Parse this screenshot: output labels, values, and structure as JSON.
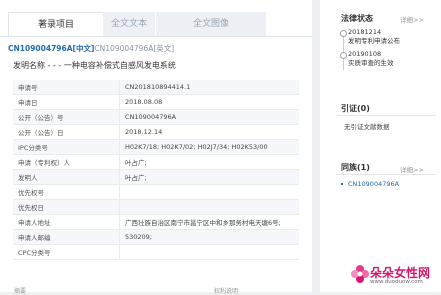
{
  "tabs": [
    {
      "label": "著录项目",
      "active": true
    },
    {
      "label": "全文文本",
      "active": false
    },
    {
      "label": "全文图像",
      "active": false
    }
  ],
  "publication": {
    "highlight": "CN109004796A[中文]",
    "alt": "CN109004796A[英文]"
  },
  "invention": {
    "label": "发明名称 - - -",
    "title": "一种电容补偿式自感风发电系统"
  },
  "fields": [
    {
      "label": "申请号",
      "value": "CN201810894414.1"
    },
    {
      "label": "申请日",
      "value": "2018.08.08"
    },
    {
      "label": "公开（公告）号",
      "value": "CN109004796A"
    },
    {
      "label": "公开（公告）日",
      "value": "2018.12.14"
    },
    {
      "label": "IPC分类号",
      "value": "H02K7/18; H02K7/02; H02J7/34; H02K53/00"
    },
    {
      "label": "申请（专利权）人",
      "value": "叶占广;"
    },
    {
      "label": "发明人",
      "value": "叶占广;"
    },
    {
      "label": "优先权号",
      "value": ""
    },
    {
      "label": "优先权日",
      "value": ""
    },
    {
      "label": "申请人地址",
      "value": "广西壮族自治区南宁市邕宁区中和乡那务村电天塘6号;"
    },
    {
      "label": "申请人邮编",
      "value": "530209;"
    },
    {
      "label": "CPC分类号",
      "value": ""
    }
  ],
  "bottom_labels": [
    "摘要",
    "权利说明"
  ],
  "legal_status": {
    "title": "法律状态",
    "detail": "详细>>",
    "events": [
      {
        "date": "20181214",
        "desc": "发明专利申请公布"
      },
      {
        "date": "20190108",
        "desc": "实质审查的生效"
      }
    ]
  },
  "citations": {
    "title": "引证(0)",
    "empty_text": "无引证文献数据"
  },
  "family": {
    "title": "同族(1)",
    "detail": "详细>>",
    "items": [
      "CN109004796A"
    ]
  },
  "watermark": {
    "text": "朵朵女性网",
    "url": "www.duoduow.com"
  },
  "colors": {
    "link": "#2369b4",
    "watermark": "#d8156f"
  }
}
